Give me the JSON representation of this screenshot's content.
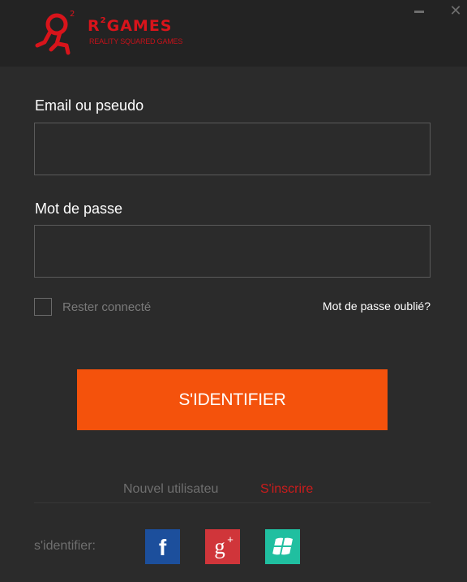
{
  "brand": {
    "title_main": "R",
    "title_sup": "2",
    "title_rest": "GAMES",
    "tagline": "REALITY SQUARED GAMES",
    "mark_sup": "2",
    "color": "#d8141b"
  },
  "window": {
    "minimize_icon": "minimize-icon",
    "close_glyph": "✕"
  },
  "form": {
    "email_label": "Email ou pseudo",
    "email_value": "",
    "password_label": "Mot de passe",
    "password_value": "",
    "remember_label": "Rester connecté",
    "remember_checked": false,
    "forgot_label": "Mot de passe oublié?",
    "signin_label": "S'IDENTIFIER",
    "signin_color": "#f4520c"
  },
  "register": {
    "new_user_label": "Nouvel utilisateu",
    "signup_label": "S'inscrire",
    "signup_color": "#cc1c1c"
  },
  "social": {
    "label": "s'identifier:",
    "items": [
      {
        "name": "facebook",
        "glyph": "f",
        "icon": "facebook-icon",
        "color": "#1c4f9c"
      },
      {
        "name": "google-plus",
        "glyph": "g",
        "sup": "+",
        "icon": "google-plus-icon",
        "color": "#d0353a"
      },
      {
        "name": "windows",
        "icon": "windows-icon",
        "color": "#20bfa0"
      }
    ]
  }
}
